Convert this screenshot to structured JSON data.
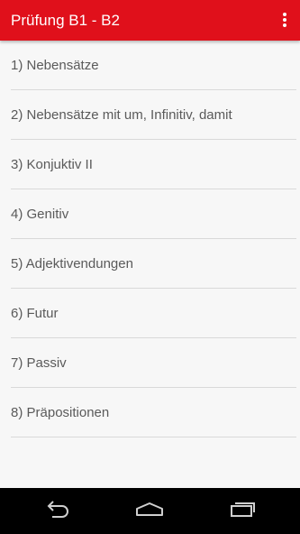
{
  "app_bar": {
    "title": "Prüfung B1 - B2",
    "color": "#e0101b",
    "overflow_icon": "more-vert-icon"
  },
  "list": {
    "items": [
      {
        "label": "1) Nebensätze"
      },
      {
        "label": "2) Nebensätze mit um, Infinitiv, damit"
      },
      {
        "label": "3) Konjuktiv II"
      },
      {
        "label": "4) Genitiv"
      },
      {
        "label": "5) Adjektivendungen"
      },
      {
        "label": "6) Futur"
      },
      {
        "label": "7) Passiv"
      },
      {
        "label": "8) Präpositionen"
      }
    ]
  },
  "nav_bar": {
    "back_icon": "back-icon",
    "home_icon": "home-icon",
    "recents_icon": "recents-icon"
  }
}
